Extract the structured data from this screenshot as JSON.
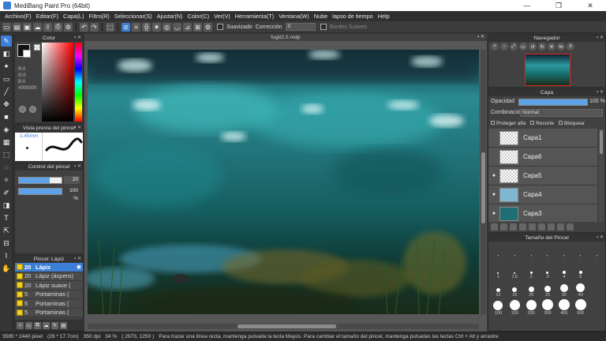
{
  "window": {
    "title": "MediBang Paint Pro (64bit)",
    "minimize": "—",
    "maximize": "❐",
    "close": "✕"
  },
  "menu": [
    "Archivo(F)",
    "Editar(F)",
    "Capa(L)",
    "Filtro(R)",
    "Seleccionar(S)",
    "Ajustar(N)",
    "Color(C)",
    "Ver(V)",
    "Herramienta(T)",
    "Ventana(W)",
    "Nube",
    "lapso de tiempo",
    "Help"
  ],
  "toolbar": {
    "smooth_label": "Suavizado",
    "correction_label": "Corrección",
    "correction_value": "0",
    "soft_edges_label": "Bordes Suaves"
  },
  "colors": {
    "accent": "#3d7fd6",
    "panel": "#414141",
    "bg": "#3a3a3a"
  },
  "color_panel": {
    "title": "Color",
    "r": "R:0",
    "g": "G:0",
    "b": "B:0",
    "hex": "#000000"
  },
  "brush_preview": {
    "title": "Vista previa del pincel",
    "size": "1.45mm"
  },
  "brush_control": {
    "title": "Control del pincel",
    "size_value": "20",
    "opacity_value": "100 %",
    "size_fraction": 0.72,
    "opacity_fraction": 1.0
  },
  "brush_list": {
    "title": "Pincel: Lápiz",
    "items": [
      {
        "num": "20",
        "name": "Lápiz",
        "selected": true
      },
      {
        "num": "20",
        "name": "Lápiz (áspero)",
        "selected": false
      },
      {
        "num": "20",
        "name": "Lápiz suave (",
        "selected": false
      },
      {
        "num": "5",
        "name": "Portaminas (",
        "selected": false
      },
      {
        "num": "5",
        "name": "Portaminas (",
        "selected": false
      },
      {
        "num": "5",
        "name": "Portaminas (",
        "selected": false
      }
    ]
  },
  "document": {
    "tab": "fugit2.0.mdp"
  },
  "navigator": {
    "title": "Navegador"
  },
  "layers_panel": {
    "title": "Capa",
    "opacity_label": "Opacidad",
    "opacity_value": "100 %",
    "blend_label": "Combinación",
    "blend_value": "Normal",
    "protect_alpha": "Proteger alfa",
    "clip": "Recorte",
    "lock": "Bloquear",
    "layers": [
      {
        "name": "Capa1",
        "visible": false
      },
      {
        "name": "Capa6",
        "visible": false
      },
      {
        "name": "Capa5",
        "visible": true
      },
      {
        "name": "Capa4",
        "visible": true
      },
      {
        "name": "Capa3",
        "visible": true
      }
    ]
  },
  "brush_size_panel": {
    "title": "Tamaño del Pincel",
    "sizes": [
      ".",
      ".",
      ".",
      ".",
      ".",
      ".",
      ".",
      "1",
      "1.5",
      "2",
      "3",
      "4",
      "5",
      "",
      "12",
      "15",
      "20",
      "25",
      "30",
      "40",
      "",
      "100",
      "150",
      "200",
      "300",
      "400",
      "500",
      ""
    ]
  },
  "status": {
    "dimensions": "3585 * 2440 pixel",
    "cm": "(26 * 17.7cm)",
    "dpi": "350 dpi",
    "zoom": "34 %",
    "coords": "( 2973, 1250 )",
    "hint": "Para trazar una línea recta, mantenga pulsada la tecla Mayús. Para cambiar el tamaño del pincel, mantenga pulsadas las teclas Ctrl + Alt y arrastre"
  }
}
